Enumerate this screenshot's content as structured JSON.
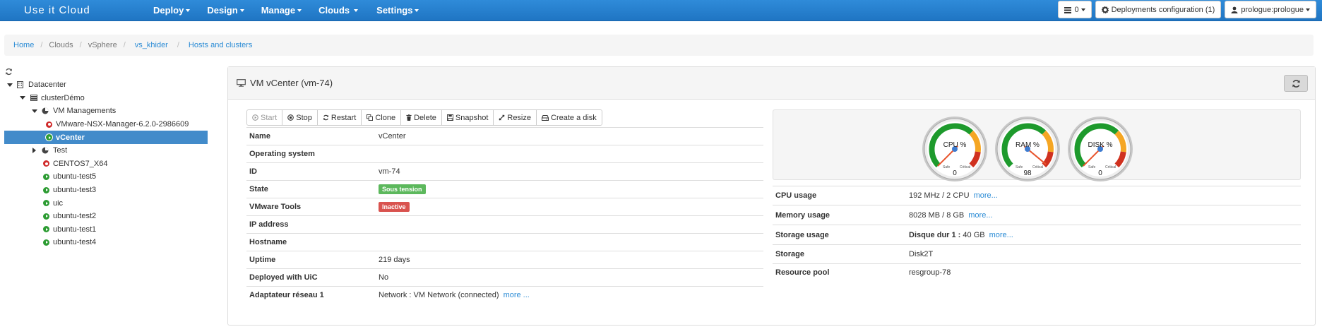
{
  "navbar": {
    "brand": "Use it Cloud",
    "menu": [
      {
        "label": "Deploy"
      },
      {
        "label": "Design"
      },
      {
        "label": "Manage"
      },
      {
        "label": "Clouds"
      },
      {
        "label": "Settings"
      }
    ],
    "queue_count": "0",
    "deployments_config": "Deployments configuration (1)",
    "user": "prologue:prologue"
  },
  "breadcrumb": {
    "home": "Home",
    "clouds": "Clouds",
    "vsphere": "vSphere",
    "vs_khider": "vs_khider",
    "hosts": "Hosts and clusters"
  },
  "tree": {
    "datacenter": "Datacenter",
    "cluster": "clusterDémo",
    "vm_managements": "VM Managements",
    "nsx": "VMware-NSX-Manager-6.2.0-2986609",
    "vcenter": "vCenter",
    "test": "Test",
    "centos": "CENTOS7_X64",
    "ubuntu_test5": "ubuntu-test5",
    "ubuntu_test3": "ubuntu-test3",
    "uic": "uic",
    "ubuntu_test2": "ubuntu-test2",
    "ubuntu_test1": "ubuntu-test1",
    "ubuntu_test4": "ubuntu-test4"
  },
  "panel": {
    "title": "VM vCenter (vm-74)"
  },
  "toolbar": {
    "start": "Start",
    "stop": "Stop",
    "restart": "Restart",
    "clone": "Clone",
    "delete": "Delete",
    "snapshot": "Snapshot",
    "resize": "Resize",
    "create_disk": "Create a disk"
  },
  "details": {
    "name_k": "Name",
    "name_v": "vCenter",
    "os_k": "Operating system",
    "os_v": "",
    "id_k": "ID",
    "id_v": "vm-74",
    "state_k": "State",
    "state_v": "Sous tension",
    "tools_k": "VMware Tools",
    "tools_v": "Inactive",
    "ip_k": "IP address",
    "ip_v": "",
    "host_k": "Hostname",
    "host_v": "",
    "uptime_k": "Uptime",
    "uptime_v": "219 days",
    "deployed_k": "Deployed with UiC",
    "deployed_v": "No",
    "net_k": "Adaptateur réseau 1",
    "net_v": "Network : VM Network (connected)",
    "net_more": "more ..."
  },
  "gauges": [
    {
      "label": "CPU %",
      "value": 0
    },
    {
      "label": "RAM %",
      "value": 98
    },
    {
      "label": "DISK %",
      "value": 0
    }
  ],
  "gauge_text": {
    "safe": "Safe",
    "critical": "Critical"
  },
  "usage": {
    "cpu_k": "CPU usage",
    "cpu_v": "192 MHz / 2 CPU",
    "cpu_more": "more...",
    "mem_k": "Memory usage",
    "mem_v": "8028 MB / 8 GB",
    "mem_more": "more...",
    "stor_k": "Storage usage",
    "stor_disk": "Disque dur 1 :",
    "stor_v": "40 GB",
    "stor_more": "more...",
    "storage_k": "Storage",
    "storage_v": "Disk2T",
    "pool_k": "Resource pool",
    "pool_v": "resgroup-78"
  }
}
